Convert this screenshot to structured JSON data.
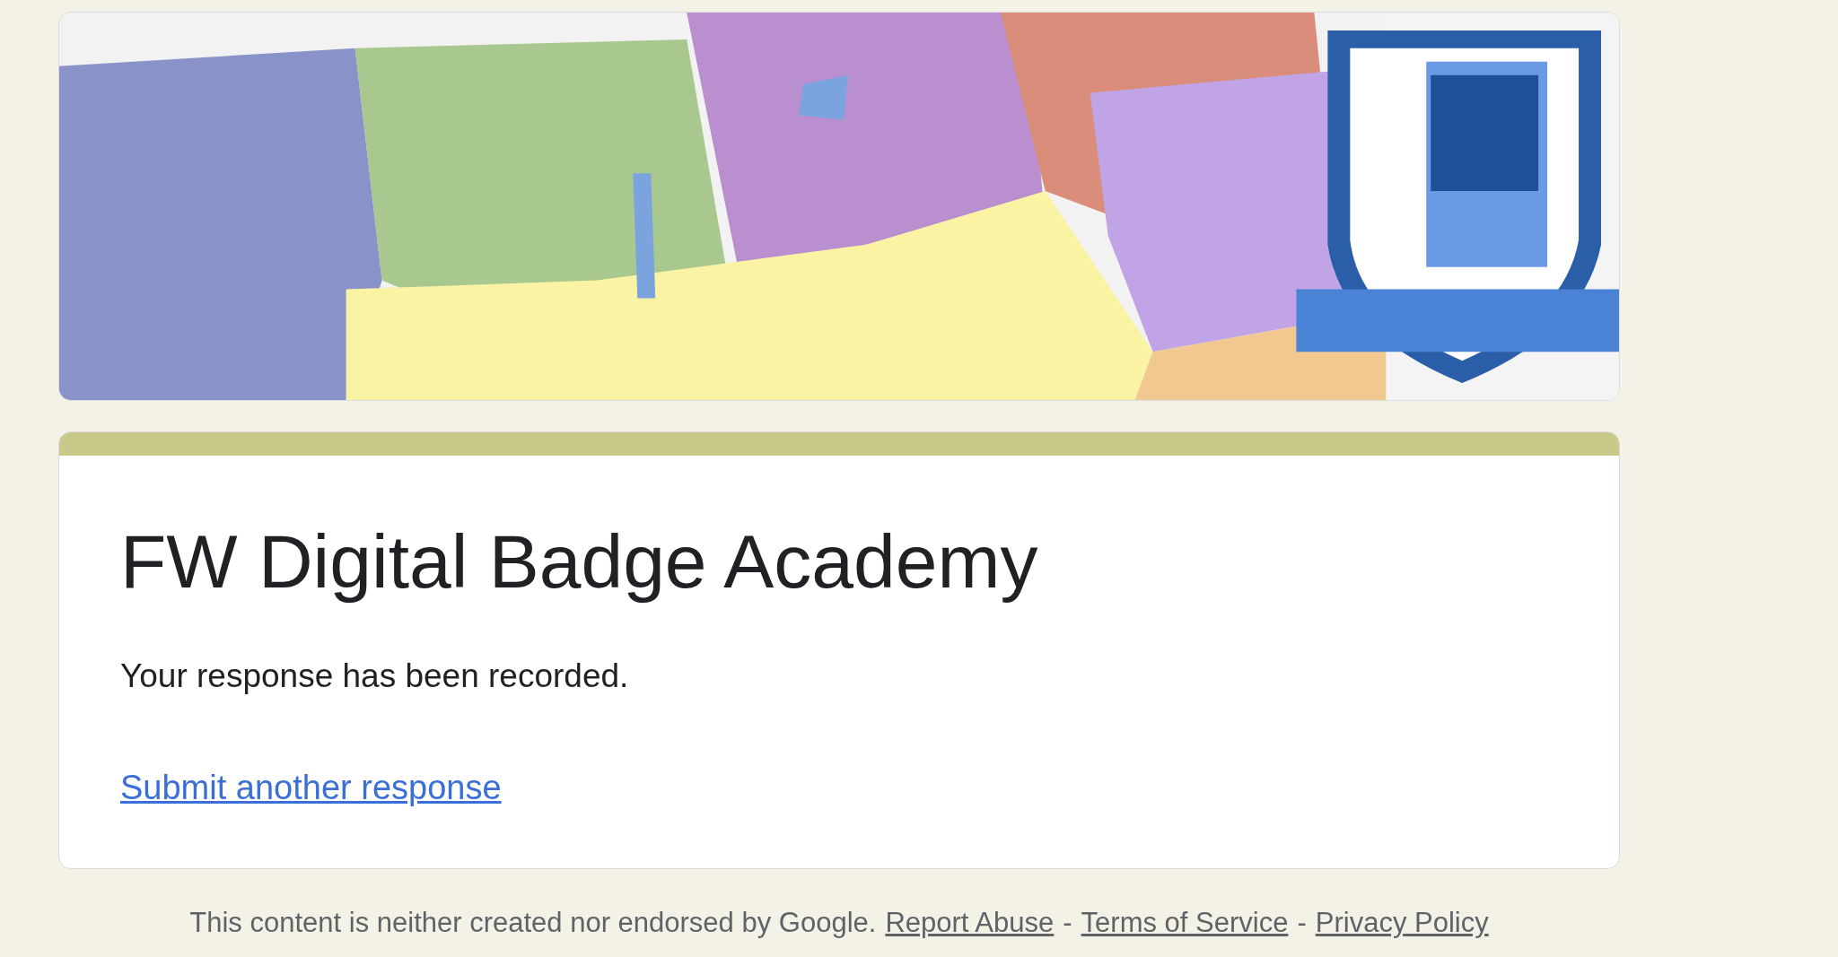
{
  "card": {
    "title": "FW Digital Badge Academy",
    "message": "Your response has been recorded.",
    "link": "Submit another response"
  },
  "footer": [
    {
      "kind": "text",
      "text": "This content is neither created nor endorsed by Google."
    },
    {
      "kind": "link",
      "text": "Report Abuse"
    },
    {
      "kind": "text",
      "text": "-"
    },
    {
      "kind": "link",
      "text": "Terms of Service"
    },
    {
      "kind": "text",
      "text": "-"
    },
    {
      "kind": "link",
      "text": "Privacy Policy"
    }
  ]
}
